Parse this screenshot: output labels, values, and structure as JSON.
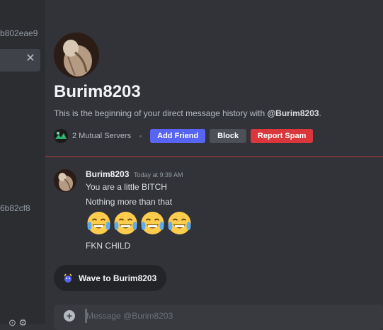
{
  "sidebar": {
    "dm_snippets": [
      "b802eae9",
      "6b82cf8"
    ],
    "close_glyph": "✕",
    "bottom_icons": "⊙ ⚙"
  },
  "profile": {
    "username": "Burim8203",
    "intro_prefix": "This is the beginning of your direct message history with ",
    "intro_mention": "@Burim8203",
    "intro_suffix": ".",
    "mutual_servers": "2 Mutual Servers"
  },
  "actions": {
    "add_friend": "Add Friend",
    "block": "Block",
    "report_spam": "Report Spam"
  },
  "message": {
    "author": "Burim8203",
    "timestamp": "Today at 9:39 AM",
    "lines": [
      "You are a little BITCH",
      "Nothing more than that"
    ],
    "emojis": [
      "joy-emoji",
      "joy-emoji",
      "joy-emoji",
      "joy-emoji"
    ],
    "last_line": "FKN CHILD"
  },
  "wave": {
    "label": "Wave to Burim8203"
  },
  "composer": {
    "placeholder": "Message @Burim8203"
  },
  "colors": {
    "blurple": "#5865f2",
    "danger": "#da373c",
    "neutral_button": "#4e5058",
    "background": "#313338",
    "sidebar": "#2b2d31"
  }
}
